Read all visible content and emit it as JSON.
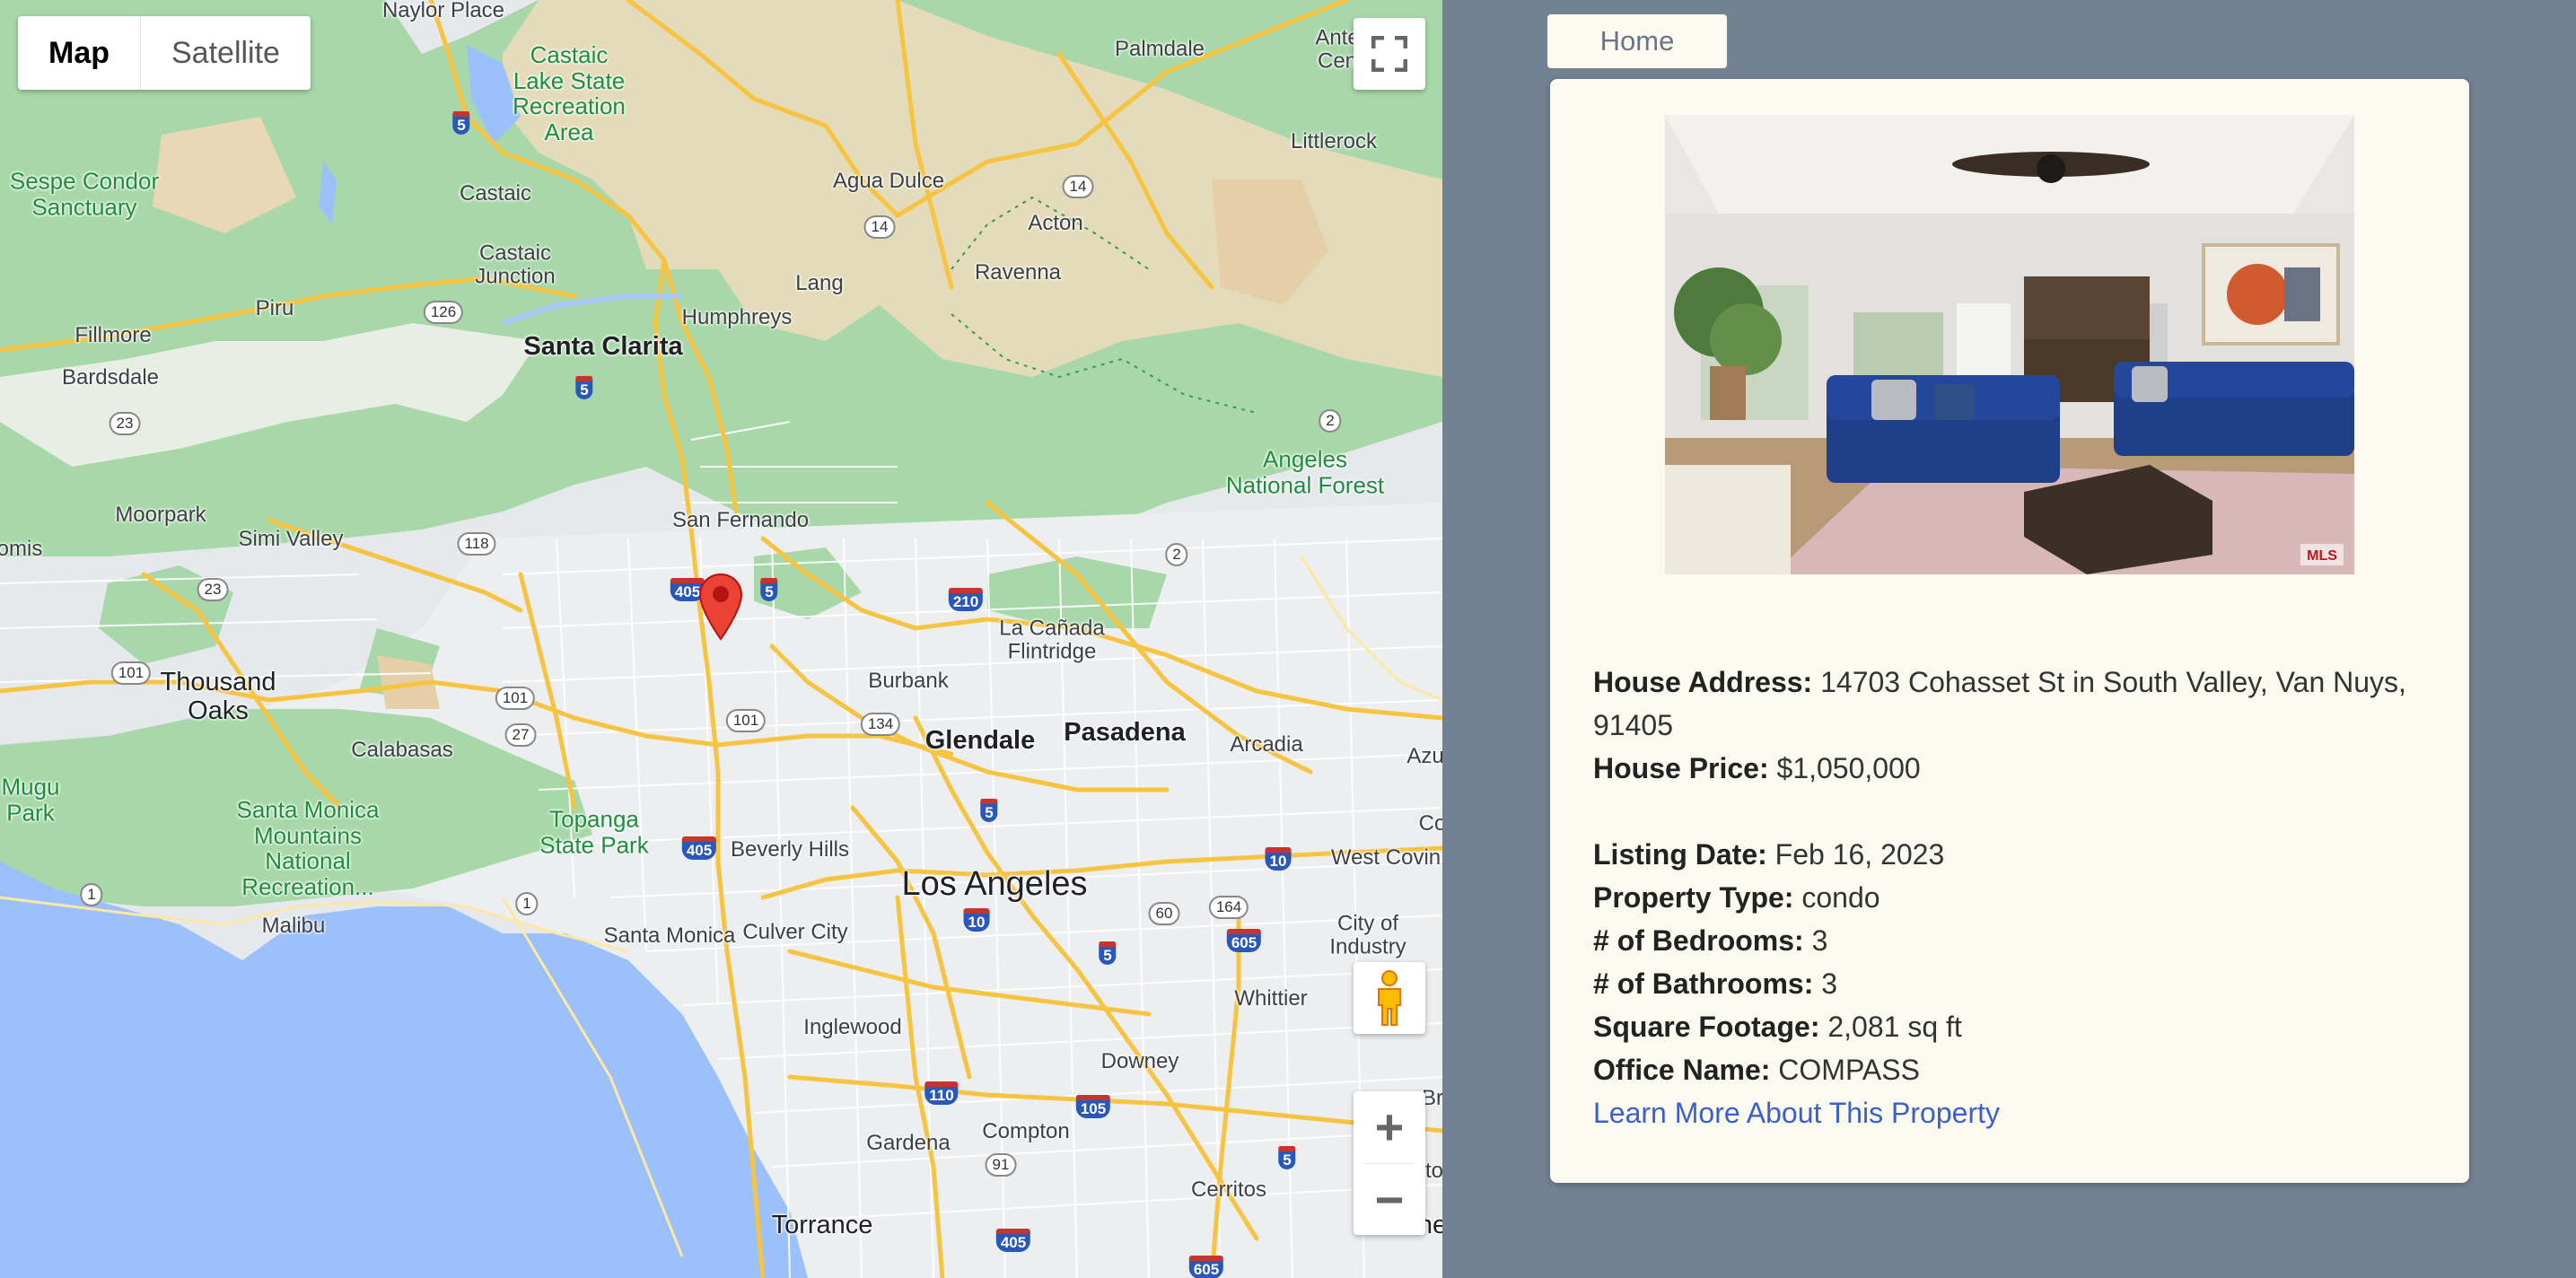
{
  "map": {
    "type_control": {
      "map_label": "Map",
      "satellite_label": "Satellite",
      "active": "Map"
    },
    "icons": {
      "fullscreen": "fullscreen-icon",
      "pegman": "pegman-icon",
      "zoom_in": "plus-icon",
      "zoom_out": "minus-icon",
      "marker": "location-pin-icon"
    },
    "labels": {
      "naylor_place": "Naylor Place",
      "castaic_lake": "Castaic\nLake State\nRecreation\nArea",
      "antelope": "Ante\nCen",
      "palmdale": "Palmdale",
      "littlerock": "Littlerock",
      "sespe": "Sespe Condor\nSanctuary",
      "castaic": "Castaic",
      "agua_dulce": "Agua Dulce",
      "acton": "Acton",
      "castaic_junction": "Castaic\nJunction",
      "ravenna": "Ravenna",
      "piru": "Piru",
      "lang": "Lang",
      "humphreys": "Humphreys",
      "fillmore": "Fillmore",
      "santa_clarita": "Santa Clarita",
      "bardsdale": "Bardsdale",
      "angeles_nf": "Angeles\nNational Forest",
      "moorpark": "Moorpark",
      "simi_valley": "Simi Valley",
      "san_fernando": "San Fernando",
      "omis": "omis",
      "la_canada": "La Cañada\nFlintridge",
      "burbank": "Burbank",
      "thousand_oaks": "Thousand\nOaks",
      "glendale": "Glendale",
      "pasadena": "Pasadena",
      "arcadia": "Arcadia",
      "azu": "Azu",
      "calabasas": "Calabasas",
      "mugu": "Mugu\nPark",
      "santa_monica_mtns": "Santa Monica\nMountains\nNational\nRecreation...",
      "topanga": "Topanga\nState Park",
      "beverly_hills": "Beverly Hills",
      "los_angeles": "Los Angeles",
      "west_covina": "West Covin",
      "co": "Co",
      "malibu": "Malibu",
      "santa_monica": "Santa Monica",
      "culver_city": "Culver City",
      "city_of_industry": "City of\nIndustry",
      "whittier": "Whittier",
      "inglewood": "Inglewood",
      "downey": "Downey",
      "br": "Br",
      "gardena": "Gardena",
      "compton": "Compton",
      "cerritos": "Cerritos",
      "to": "to",
      "torrance": "Torrance",
      "ne": "ne"
    },
    "shields": {
      "i5a": "5",
      "r14a": "14",
      "r14b": "14",
      "r126": "126",
      "i5b": "5",
      "r23a": "23",
      "r2a": "2",
      "r2b": "2",
      "r118": "118",
      "i405a": "405",
      "i5c": "5",
      "i210": "210",
      "r23b": "23",
      "us101a": "101",
      "us101b": "101",
      "us101c": "101",
      "r134": "134",
      "r27": "27",
      "i5d": "5",
      "i405b": "405",
      "i10a": "10",
      "r1a": "1",
      "r1b": "1",
      "r60": "60",
      "r164": "164",
      "i10b": "10",
      "i605a": "605",
      "i5e": "5",
      "i110": "110",
      "i105": "105",
      "r91": "91",
      "i5f": "5",
      "i405c": "405",
      "i605b": "605"
    }
  },
  "nav": {
    "home_label": "Home"
  },
  "listing": {
    "photo_alt": "living room photo",
    "address_label": "House Address:",
    "address": "14703 Cohasset St in South Valley, Van Nuys, 91405",
    "price_label": "House Price:",
    "price": "$1,050,000",
    "listing_date_label": "Listing Date:",
    "listing_date": "Feb 16, 2023",
    "property_type_label": "Property Type:",
    "property_type": "condo",
    "bedrooms_label": "# of Bedrooms:",
    "bedrooms": "3",
    "bathrooms_label": "# of Bathrooms:",
    "bathrooms": "3",
    "sqft_label": "Square Footage:",
    "sqft": "2,081 sq ft",
    "office_label": "Office Name:",
    "office": "COMPASS",
    "link_label": "Learn More About This Property"
  },
  "colors": {
    "page_bg": "#738293",
    "card_bg": "#fafaf0",
    "link": "#3d5fcc",
    "marker": "#ea4335"
  }
}
